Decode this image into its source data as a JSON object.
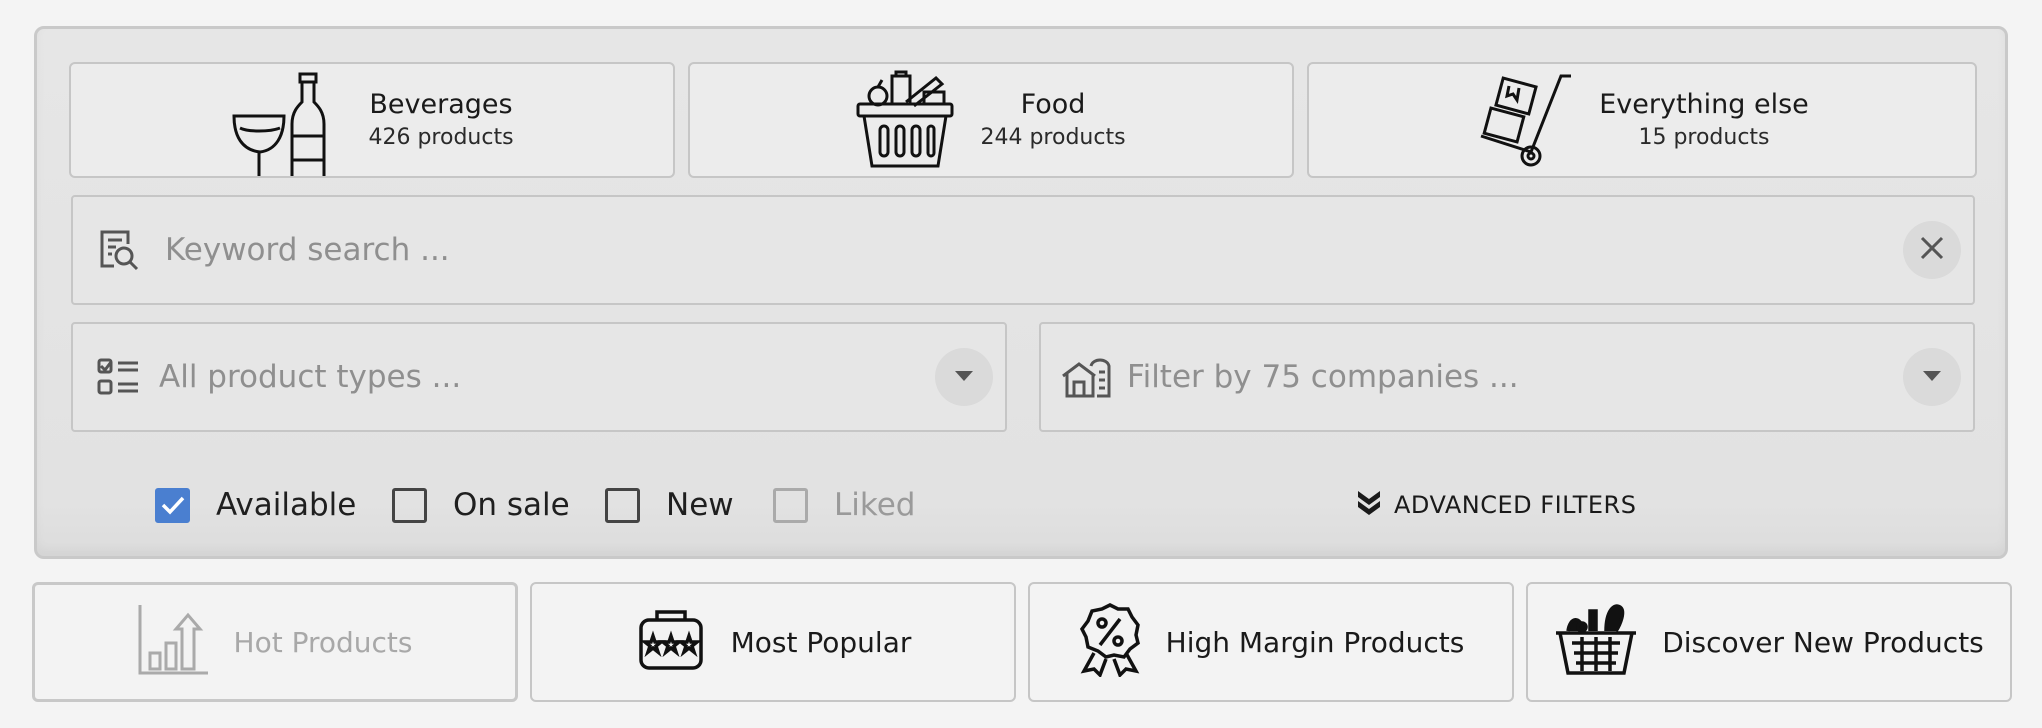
{
  "categories": [
    {
      "name": "Beverages",
      "count": "426 products",
      "icon": "wine-bottle-icon"
    },
    {
      "name": "Food",
      "count": "244 products",
      "icon": "food-basket-icon"
    },
    {
      "name": "Everything else",
      "count": "15 products",
      "icon": "hand-truck-icon"
    }
  ],
  "search": {
    "placeholder": "Keyword search ...",
    "icon": "search-list-icon",
    "clear_icon": "close-icon"
  },
  "product_types": {
    "placeholder": "All product types ...",
    "icon": "checklist-icon"
  },
  "companies": {
    "placeholder": "Filter by 75 companies ...",
    "icon": "warehouse-icon"
  },
  "filters": [
    {
      "label": "Available",
      "checked": true,
      "disabled": false
    },
    {
      "label": "On sale",
      "checked": false,
      "disabled": false
    },
    {
      "label": "New",
      "checked": false,
      "disabled": false
    },
    {
      "label": "Liked",
      "checked": false,
      "disabled": true
    }
  ],
  "advanced_filters": {
    "label": "ADVANCED FILTERS"
  },
  "quick_buttons": [
    {
      "label": "Hot Products",
      "disabled": true,
      "icon": "bar-chart-up-icon"
    },
    {
      "label": "Most Popular",
      "disabled": false,
      "icon": "star-basket-icon"
    },
    {
      "label": "High Margin Products",
      "disabled": false,
      "icon": "percent-badge-icon"
    },
    {
      "label": "Discover New Products",
      "disabled": false,
      "icon": "picnic-basket-icon"
    }
  ],
  "colors": {
    "accent": "#4a7fd0",
    "panel": "#e4e4e4",
    "border": "#c6c6c6"
  }
}
